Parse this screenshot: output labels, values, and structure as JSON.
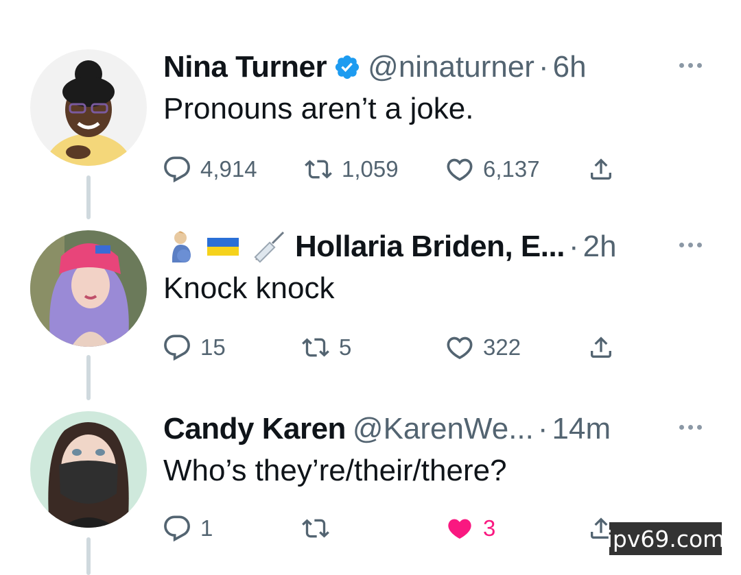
{
  "colors": {
    "text": "#0f1419",
    "secondary": "#536471",
    "like_active": "#f91880",
    "verified": "#1d9bf0",
    "thread_line": "#cfd9de"
  },
  "tweets": [
    {
      "name": "Nina Turner",
      "verified": true,
      "handle": "@ninaturner",
      "separator": "·",
      "time": "6h",
      "text": "Pronouns aren’t a joke.",
      "replies": "4,914",
      "retweets": "1,059",
      "likes": "6,137",
      "liked": false,
      "avatar": "nina-turner-avatar"
    },
    {
      "name_emojis": [
        "pregnant-man-emoji",
        "ukraine-flag-emoji",
        "syringe-emoji"
      ],
      "name": "Hollaria Briden, E...",
      "separator": "·",
      "time": "2h",
      "text": "Knock knock",
      "replies": "15",
      "retweets": "5",
      "likes": "322",
      "liked": false,
      "avatar": "hollaria-briden-avatar"
    },
    {
      "name": "Candy Karen",
      "handle": "@KarenWe...",
      "separator": "·",
      "time": "14m",
      "text": "Who’s they’re/their/there?",
      "replies": "1",
      "retweets": "",
      "likes": "3",
      "liked": true,
      "avatar": "candy-karen-avatar"
    }
  ],
  "watermark": "ipv69.com"
}
